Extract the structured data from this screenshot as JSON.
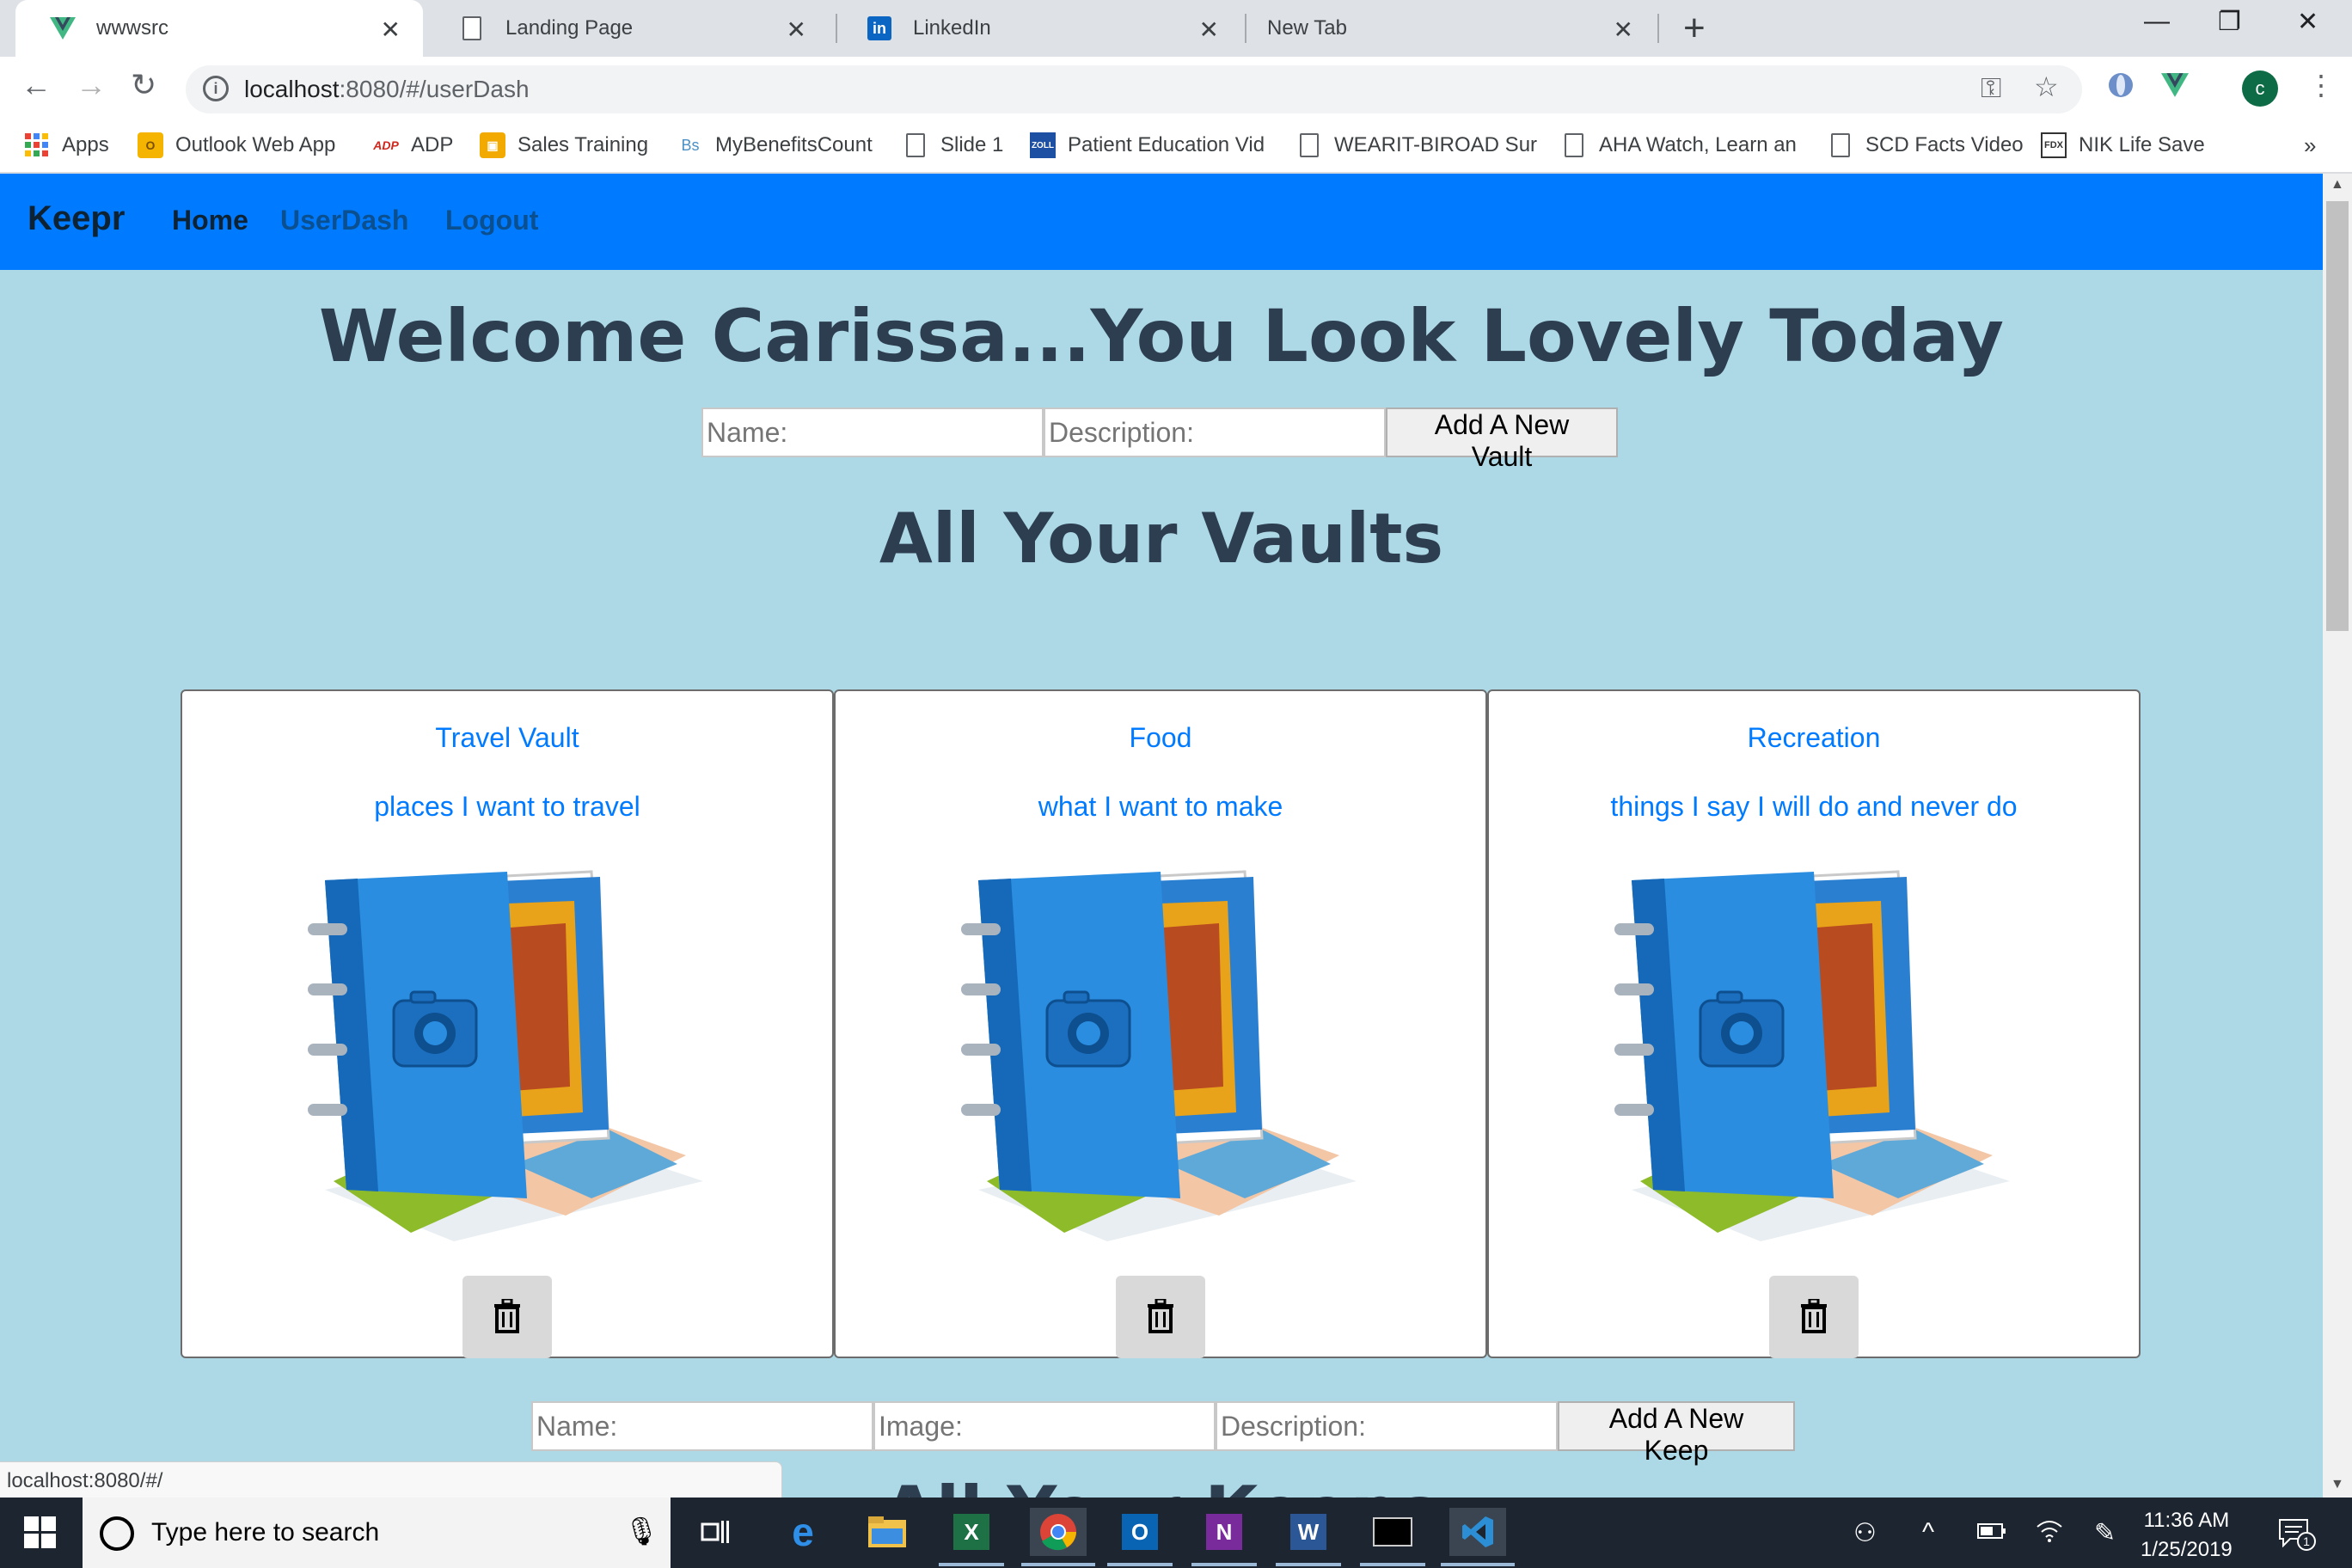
{
  "browser": {
    "tabs": [
      {
        "title": "wwwsrc",
        "icon": "vue-icon",
        "active": true
      },
      {
        "title": "Landing Page",
        "icon": "page-icon",
        "active": false
      },
      {
        "title": "LinkedIn",
        "icon": "linkedin-icon",
        "active": false
      },
      {
        "title": "New Tab",
        "icon": "none",
        "active": false
      }
    ],
    "url_host": "localhost",
    "url_rest": ":8080/#/userDash",
    "bookmarks": [
      {
        "label": "Apps",
        "icon": "apps-grid-icon"
      },
      {
        "label": "Outlook Web App",
        "icon": "outlook-icon"
      },
      {
        "label": "ADP",
        "icon": "adp-icon"
      },
      {
        "label": "Sales Training",
        "icon": "gift-icon"
      },
      {
        "label": "MyBenefitsCount",
        "icon": "bs-icon"
      },
      {
        "label": "Slide 1",
        "icon": "page-icon"
      },
      {
        "label": "Patient Education Vid",
        "icon": "zoll-icon"
      },
      {
        "label": "WEARIT-BIROAD Sur",
        "icon": "page-icon"
      },
      {
        "label": "AHA Watch, Learn an",
        "icon": "page-icon"
      },
      {
        "label": "SCD Facts Video",
        "icon": "page-icon"
      },
      {
        "label": "NIK Life Save",
        "icon": "nik-icon"
      }
    ],
    "profile_initial": "c",
    "status_url": "localhost:8080/#/"
  },
  "app": {
    "brand": "Keepr",
    "nav": [
      {
        "label": "Home",
        "color": "#0d2233"
      },
      {
        "label": "UserDash",
        "color": "#0a4f8f"
      },
      {
        "label": "Logout",
        "color": "#0a4f8f"
      }
    ],
    "welcome": "Welcome Carissa...You Look Lovely Today",
    "vault_form": {
      "name_placeholder": "Name:",
      "description_placeholder": "Description:",
      "submit_label": "Add A New Vault"
    },
    "vaults_heading": "All Your Vaults",
    "vaults": [
      {
        "name": "Travel Vault",
        "description": "places I want to travel"
      },
      {
        "name": "Food",
        "description": "what I want to make"
      },
      {
        "name": "Recreation",
        "description": "things I say I will do and never do"
      }
    ],
    "keep_form": {
      "name_placeholder": "Name:",
      "image_placeholder": "Image:",
      "description_placeholder": "Description:",
      "submit_label": "Add A New Keep"
    },
    "partial_heading": "All Your Keeps"
  },
  "taskbar": {
    "search_placeholder": "Type here to search",
    "time": "11:36 AM",
    "date": "1/25/2019",
    "notification_count": "1"
  },
  "colors": {
    "nav_bg": "#007bff",
    "page_bg": "#add8e6",
    "heading": "#2c3e50",
    "card_text": "#007bff"
  }
}
